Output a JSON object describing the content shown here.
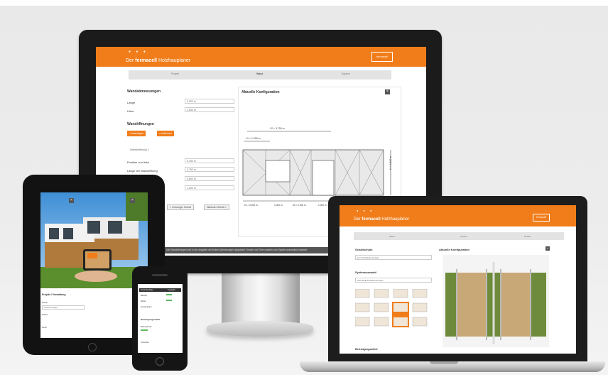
{
  "scene": {
    "description_devices": [
      "desktop-monitor",
      "laptop",
      "tablet",
      "smartphone"
    ]
  },
  "app": {
    "title_prefix": "Der",
    "title_brand": "fermacell",
    "title_suffix": "Holzhauplaner",
    "logo": "fermacell"
  },
  "desktop": {
    "steps": [
      "Projekt",
      "Wand",
      "System"
    ],
    "dimensions_title": "Wandabmessungen",
    "length_label": "Länge",
    "length_value": "2,000 m",
    "height_label": "Höhe",
    "height_value": "2,500 m",
    "openings_title": "Wandöffnungen",
    "add_button": "+ hinzufügen",
    "remove_button": "× entfernen",
    "opening_item": "Wandöffnung 1",
    "distance_label": "Position von links",
    "distance_value": "0,750 m",
    "opening_position_label": "Länge der Wandöffnung",
    "opening_position_value": "0,750 m",
    "extra_value_1": "0,800 m",
    "extra_value_2": "1,000 m",
    "prev_button": "« Vorheriger Schritt",
    "next_button": "Nächster Schritt »",
    "config_title": "Aktuelle Konfiguration",
    "dim_top": "L2 = 3,700 m",
    "dim_left": "L1 = 1,200 m",
    "dim_right": "H = 2,500 m",
    "dim_bottom": [
      "b1 = 0,200 m",
      "1,000 m",
      "b2 = 0,200 m",
      "1,000 m"
    ],
    "footer_text": "Alle Wandoffnungen sind in den Angaben der lichten Abmessungen dargestellt. Fenster und Türen werden vom System automatisch platziert."
  },
  "laptop": {
    "steps": [
      "Wand",
      "System",
      "Details"
    ],
    "left_title": "Schallschutz",
    "select_value": "kein Schallschutzmittel",
    "system_title": "Systemauswahl",
    "system_option": "fermacell Holzrahmenwand",
    "bottom_title": "Befestigungsmittel",
    "config_title": "Aktuelle Konfiguration"
  },
  "tablet": {
    "section_title": "Projekt / Verwaltung",
    "fields": [
      "Name",
      "Neues Projekt",
      "Datum",
      "Notiz"
    ]
  },
  "phone": {
    "header_left": "Schichtaufbau",
    "header_right": "Auswahl",
    "rows": [
      "Bauteil",
      "Wand",
      "Konstruktion"
    ],
    "section": "Befestigungsmittel",
    "row_extra": "Brandschutz",
    "footer_label": "Vorschau"
  },
  "colors": {
    "brand_orange": "#f07d1a",
    "device_black": "#1b1b1b"
  }
}
